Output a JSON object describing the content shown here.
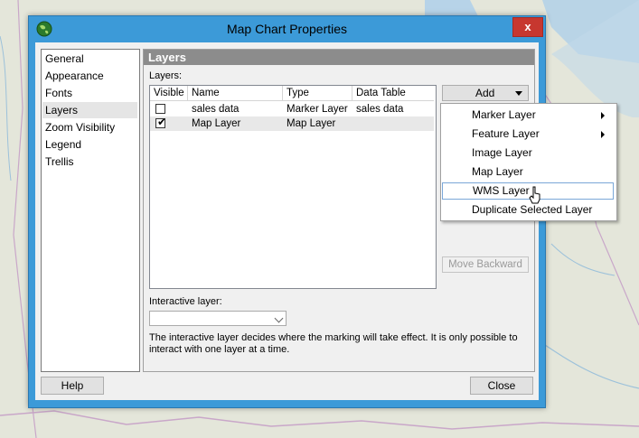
{
  "window": {
    "title": "Map Chart Properties",
    "close_label": "x"
  },
  "nav": {
    "items": [
      {
        "label": "General"
      },
      {
        "label": "Appearance"
      },
      {
        "label": "Fonts"
      },
      {
        "label": "Layers",
        "selected": true
      },
      {
        "label": "Zoom Visibility"
      },
      {
        "label": "Legend"
      },
      {
        "label": "Trellis"
      }
    ]
  },
  "panel": {
    "title": "Layers",
    "layers_label": "Layers:",
    "columns": [
      "Visible",
      "Name",
      "Type",
      "Data Table"
    ],
    "rows": [
      {
        "visible": false,
        "name": "sales data",
        "type": "Marker Layer",
        "data_table": "sales data"
      },
      {
        "visible": true,
        "name": "Map Layer",
        "type": "Map Layer",
        "data_table": ""
      }
    ],
    "check_glyph": "✔",
    "add_button": "Add",
    "move_backward_button": "Move Backward",
    "interactive_label": "Interactive layer:",
    "interactive_value": "",
    "help_text": "The interactive layer decides where the marking will take effect. It is only possible to interact with one layer at a time."
  },
  "buttons": {
    "help": "Help",
    "close": "Close"
  },
  "add_menu": {
    "items": [
      {
        "label": "Marker Layer",
        "submenu": true
      },
      {
        "label": "Feature Layer",
        "submenu": true
      },
      {
        "label": "Image Layer",
        "submenu": false
      },
      {
        "label": "Map Layer",
        "submenu": false
      },
      {
        "label": "WMS Layer",
        "submenu": false,
        "hovered": true
      },
      {
        "label": "Duplicate Selected Layer",
        "submenu": false
      }
    ]
  },
  "colors": {
    "title_bar": "#3c9ad8",
    "close_red": "#c7372f",
    "panel_header": "#8c8c8c"
  }
}
